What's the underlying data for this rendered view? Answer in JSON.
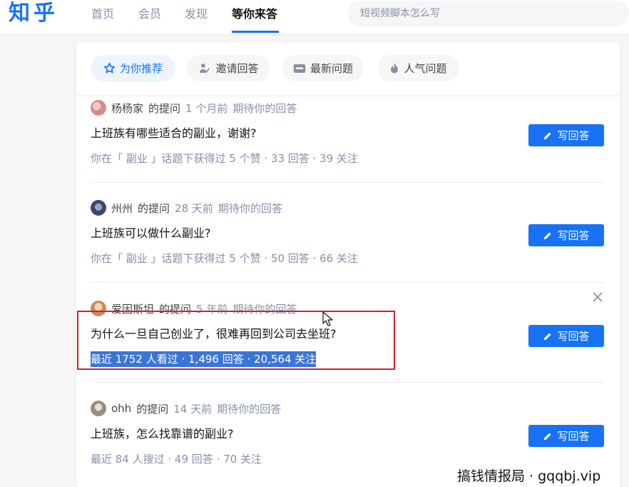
{
  "header": {
    "logo": "知乎",
    "nav": [
      {
        "label": "首页"
      },
      {
        "label": "会员"
      },
      {
        "label": "发现"
      },
      {
        "label": "等你来答"
      }
    ],
    "search_placeholder": "短视频脚本怎么写"
  },
  "tabs": [
    {
      "label": "为你推荐",
      "icon": "star-icon",
      "active": true
    },
    {
      "label": "邀请回答",
      "icon": "invite-user-icon",
      "active": false
    },
    {
      "label": "最新问题",
      "icon": "new-badge-icon",
      "active": false
    },
    {
      "label": "人气问题",
      "icon": "fire-icon",
      "active": false
    }
  ],
  "questions": [
    {
      "author": "杨杨家",
      "asked": "的提问",
      "time": "1 个月前",
      "expect": "期待你的回答",
      "title": "上班族有哪些适合的副业，谢谢?",
      "stats": "你在「 副业 」话题下获得过 5 个赞 · 33 回答 · 39 关注",
      "button": "写回答",
      "avatar_color": "#d98b8b"
    },
    {
      "author": "州州",
      "asked": "的提问",
      "time": "28 天前",
      "expect": "期待你的回答",
      "title": "上班族可以做什么副业?",
      "stats": "你在「 副业 」话题下获得过 5 个赞 · 50 回答 · 66 关注",
      "button": "写回答",
      "avatar_color": "#3b4a6b"
    },
    {
      "author": "爱因斯坦",
      "asked": "的提问",
      "time": "5 年前",
      "expect": "期待你的回答",
      "title": "为什么一旦自己创业了，很难再回到公司去坐班?",
      "stats": "最近 1752 人看过 · 1,496 回答 · 20,564 关注",
      "button": "写回答",
      "avatar_color": "#c98a5a"
    },
    {
      "author": "ohh",
      "asked": "的提问",
      "time": "14 天前",
      "expect": "期待你的回答",
      "title": "上班族，怎么找靠谱的副业?",
      "stats": "最近 84 人搜过 · 49 回答 · 70 关注",
      "button": "写回答",
      "avatar_color": "#9a8f7d"
    }
  ],
  "watermark": "搞钱情报局 · gqqbj.vip",
  "colors": {
    "brand": "#1772f6",
    "annotation_box": "#d2232a",
    "selection": "#3a76d8"
  }
}
